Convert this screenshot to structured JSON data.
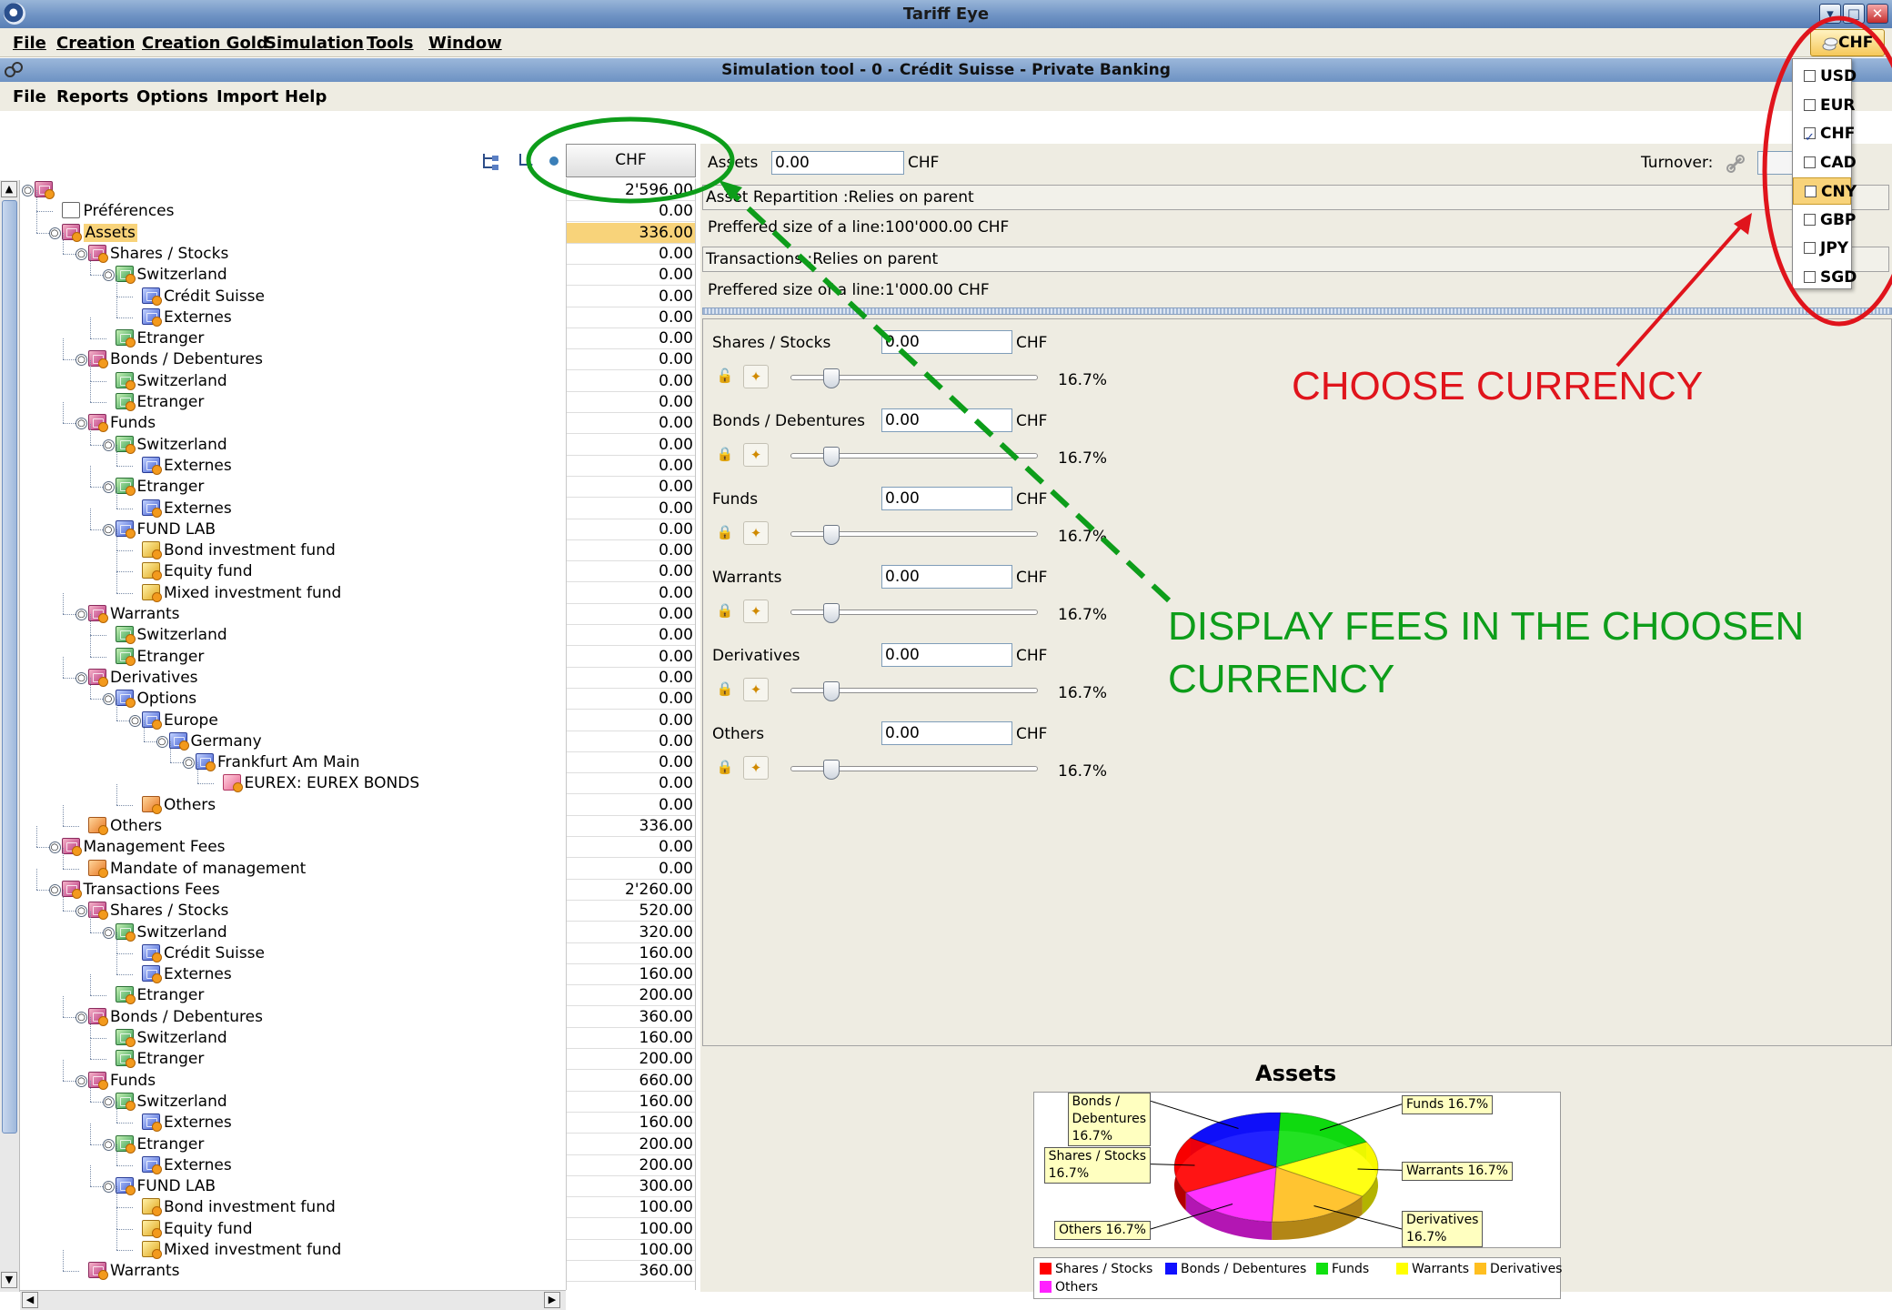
{
  "window": {
    "title": "Tariff Eye"
  },
  "main_menu": [
    "File",
    "Creation",
    "Creation Gold",
    "Simulation",
    "Tools",
    "Window"
  ],
  "subwindow": {
    "title": "Simulation tool - 0 - Crédit Suisse - Private Banking"
  },
  "sub_menu": [
    "File",
    "Reports",
    "Options",
    "Import",
    "Help"
  ],
  "currency_button": "CHF",
  "currency_options": [
    {
      "code": "USD",
      "checked": false
    },
    {
      "code": "EUR",
      "checked": false
    },
    {
      "code": "CHF",
      "checked": true
    },
    {
      "code": "CAD",
      "checked": false
    },
    {
      "code": "CNY",
      "checked": false,
      "highlighted": true
    },
    {
      "code": "GBP",
      "checked": false
    },
    {
      "code": "JPY",
      "checked": false
    },
    {
      "code": "SGD",
      "checked": false
    }
  ],
  "value_column_header": "CHF",
  "tree": [
    {
      "label": "",
      "depth": 0,
      "icon": "pink-folder-icon",
      "value": "2'596.00"
    },
    {
      "label": "Préférences",
      "depth": 1,
      "icon": "preferences-icon",
      "value": "0.00"
    },
    {
      "label": "Assets",
      "depth": 1,
      "icon": "pink-folder-icon",
      "value": "336.00",
      "selected": true
    },
    {
      "label": "Shares / Stocks",
      "depth": 2,
      "icon": "pink-folder-icon",
      "value": "0.00"
    },
    {
      "label": "Switzerland",
      "depth": 3,
      "icon": "green-folder-icon",
      "value": "0.00"
    },
    {
      "label": "Crédit Suisse",
      "depth": 4,
      "icon": "blue-item-icon",
      "value": "0.00"
    },
    {
      "label": "Externes",
      "depth": 4,
      "icon": "blue-item-icon",
      "value": "0.00"
    },
    {
      "label": "Etranger",
      "depth": 3,
      "icon": "green-item-icon",
      "value": "0.00"
    },
    {
      "label": "Bonds / Debentures",
      "depth": 2,
      "icon": "pink-folder-icon",
      "value": "0.00"
    },
    {
      "label": "Switzerland",
      "depth": 3,
      "icon": "green-item-icon",
      "value": "0.00"
    },
    {
      "label": "Etranger",
      "depth": 3,
      "icon": "green-item-icon",
      "value": "0.00"
    },
    {
      "label": "Funds",
      "depth": 2,
      "icon": "pink-folder-icon",
      "value": "0.00"
    },
    {
      "label": "Switzerland",
      "depth": 3,
      "icon": "green-folder-icon",
      "value": "0.00"
    },
    {
      "label": "Externes",
      "depth": 4,
      "icon": "blue-item-icon",
      "value": "0.00"
    },
    {
      "label": "Etranger",
      "depth": 3,
      "icon": "green-folder-icon",
      "value": "0.00"
    },
    {
      "label": "Externes",
      "depth": 4,
      "icon": "blue-item-icon",
      "value": "0.00"
    },
    {
      "label": "FUND LAB",
      "depth": 3,
      "icon": "blue-folder-icon",
      "value": "0.00"
    },
    {
      "label": "Bond investment fund",
      "depth": 4,
      "icon": "yellow-item-icon",
      "value": "0.00"
    },
    {
      "label": "Equity fund",
      "depth": 4,
      "icon": "yellow-item-icon",
      "value": "0.00"
    },
    {
      "label": "Mixed investment fund",
      "depth": 4,
      "icon": "yellow-item-icon",
      "value": "0.00"
    },
    {
      "label": "Warrants",
      "depth": 2,
      "icon": "pink-folder-icon",
      "value": "0.00"
    },
    {
      "label": "Switzerland",
      "depth": 3,
      "icon": "green-item-icon",
      "value": "0.00"
    },
    {
      "label": "Etranger",
      "depth": 3,
      "icon": "green-item-icon",
      "value": "0.00"
    },
    {
      "label": "Derivatives",
      "depth": 2,
      "icon": "pink-folder-icon",
      "value": "0.00"
    },
    {
      "label": "Options",
      "depth": 3,
      "icon": "purple-folder-icon",
      "value": "0.00"
    },
    {
      "label": "Europe",
      "depth": 4,
      "icon": "purple-folder-icon",
      "value": "0.00"
    },
    {
      "label": "Germany",
      "depth": 5,
      "icon": "purple-folder-icon",
      "value": "0.00"
    },
    {
      "label": "Frankfurt Am Main",
      "depth": 6,
      "icon": "purple-folder-icon",
      "value": "0.00"
    },
    {
      "label": "EUREX: EUREX BONDS",
      "depth": 7,
      "icon": "pink-item-icon",
      "value": "0.00"
    },
    {
      "label": "Others",
      "depth": 4,
      "icon": "orange-item-icon",
      "value": "0.00"
    },
    {
      "label": "Others",
      "depth": 2,
      "icon": "orange-item-icon",
      "value": "336.00"
    },
    {
      "label": "Management Fees",
      "depth": 1,
      "icon": "pink-folder-icon",
      "value": "0.00"
    },
    {
      "label": "Mandate of management",
      "depth": 2,
      "icon": "orange-item-icon",
      "value": "0.00"
    },
    {
      "label": "Transactions Fees",
      "depth": 1,
      "icon": "pink-folder-icon",
      "value": "2'260.00"
    },
    {
      "label": "Shares / Stocks",
      "depth": 2,
      "icon": "pink-folder-icon",
      "value": "520.00"
    },
    {
      "label": "Switzerland",
      "depth": 3,
      "icon": "green-folder-icon",
      "value": "320.00"
    },
    {
      "label": "Crédit Suisse",
      "depth": 4,
      "icon": "blue-item-icon",
      "value": "160.00"
    },
    {
      "label": "Externes",
      "depth": 4,
      "icon": "blue-item-icon",
      "value": "160.00"
    },
    {
      "label": "Etranger",
      "depth": 3,
      "icon": "green-item-icon",
      "value": "200.00"
    },
    {
      "label": "Bonds / Debentures",
      "depth": 2,
      "icon": "pink-folder-icon",
      "value": "360.00"
    },
    {
      "label": "Switzerland",
      "depth": 3,
      "icon": "green-item-icon",
      "value": "160.00"
    },
    {
      "label": "Etranger",
      "depth": 3,
      "icon": "green-item-icon",
      "value": "200.00"
    },
    {
      "label": "Funds",
      "depth": 2,
      "icon": "pink-folder-icon",
      "value": "660.00"
    },
    {
      "label": "Switzerland",
      "depth": 3,
      "icon": "green-folder-icon",
      "value": "160.00"
    },
    {
      "label": "Externes",
      "depth": 4,
      "icon": "blue-item-icon",
      "value": "160.00"
    },
    {
      "label": "Etranger",
      "depth": 3,
      "icon": "green-folder-icon",
      "value": "200.00"
    },
    {
      "label": "Externes",
      "depth": 4,
      "icon": "blue-item-icon",
      "value": "200.00"
    },
    {
      "label": "FUND LAB",
      "depth": 3,
      "icon": "blue-folder-icon",
      "value": "300.00"
    },
    {
      "label": "Bond investment fund",
      "depth": 4,
      "icon": "yellow-item-icon",
      "value": "100.00"
    },
    {
      "label": "Equity fund",
      "depth": 4,
      "icon": "yellow-item-icon",
      "value": "100.00"
    },
    {
      "label": "Mixed investment fund",
      "depth": 4,
      "icon": "yellow-item-icon",
      "value": "100.00"
    },
    {
      "label": "Warrants",
      "depth": 2,
      "icon": "pink-folder-icon",
      "value": "360.00"
    }
  ],
  "details": {
    "assets_label": "Assets",
    "assets_value": "0.00",
    "assets_unit": "CHF",
    "turnover_label": "Turnover:",
    "asset_repartition": "Asset Repartition :Relies on parent",
    "preferred_size_assets": "Preffered size of a line:100'000.00 CHF",
    "transactions": "Transactions :Relies on parent",
    "preferred_size_transactions": "Preffered size of a line:1'000.00 CHF"
  },
  "allocations": [
    {
      "label": "Shares / Stocks",
      "value": "0.00",
      "unit": "CHF",
      "percent": "16.7%",
      "share": 0.167
    },
    {
      "label": "Bonds / Debentures",
      "value": "0.00",
      "unit": "CHF",
      "percent": "16.7%",
      "share": 0.167
    },
    {
      "label": "Funds",
      "value": "0.00",
      "unit": "CHF",
      "percent": "16.7%",
      "share": 0.167
    },
    {
      "label": "Warrants",
      "value": "0.00",
      "unit": "CHF",
      "percent": "16.7%",
      "share": 0.167
    },
    {
      "label": "Derivatives",
      "value": "0.00",
      "unit": "CHF",
      "percent": "16.7%",
      "share": 0.167
    },
    {
      "label": "Others",
      "value": "0.00",
      "unit": "CHF",
      "percent": "16.7%",
      "share": 0.167
    }
  ],
  "chart_data": {
    "type": "pie",
    "title": "Assets",
    "categories": [
      "Shares / Stocks",
      "Bonds / Debentures",
      "Funds",
      "Warrants",
      "Derivatives",
      "Others"
    ],
    "values": [
      16.7,
      16.7,
      16.7,
      16.7,
      16.7,
      16.7
    ],
    "colors": [
      "#ff0000",
      "#1010ff",
      "#10e010",
      "#ffff00",
      "#ffbf20",
      "#ff20ff"
    ],
    "slice_labels": {
      "Bonds / Debentures": [
        "Bonds /",
        "Debentures",
        "16.7%"
      ],
      "Shares / Stocks": [
        "Shares / Stocks",
        "16.7%"
      ],
      "Others": [
        "Others 16.7%"
      ],
      "Funds": [
        "Funds 16.7%"
      ],
      "Warrants": [
        "Warrants 16.7%"
      ],
      "Derivatives": [
        "Derivatives",
        "16.7%"
      ]
    },
    "legend": [
      "Shares / Stocks",
      "Bonds / Debentures",
      "Funds",
      "Warrants",
      "Derivatives",
      "Others"
    ],
    "legend_position": "bottom"
  },
  "annotations": {
    "choose_currency": "CHOOSE CURRENCY",
    "display_fees_line1": "DISPLAY FEES IN THE CHOOSEN",
    "display_fees_line2": "CURRENCY",
    "red_color": "#e0141c",
    "green_color": "#0d9d1a"
  }
}
